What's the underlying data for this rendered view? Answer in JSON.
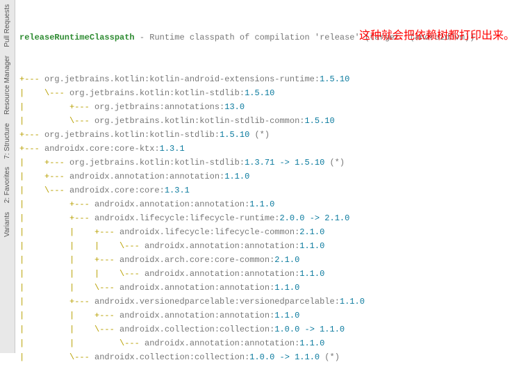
{
  "sidebar": {
    "tabs": [
      {
        "label": "Pull Requests"
      },
      {
        "label": "Resource Manager"
      },
      {
        "label": "7: Structure"
      },
      {
        "label": "2: Favorites"
      },
      {
        "label": "Variants"
      }
    ]
  },
  "header": {
    "classpath": "releaseRuntimeClasspath",
    "desc": " - Runtime classpath of compilation 'release' (target  (androidJvm))."
  },
  "annotation": "这种就会把依赖树都打印出来。也就是三方库又依赖了其他的依赖库",
  "lines": [
    {
      "prefix": "+--- ",
      "pkg": "org.jetbrains.kotlin:kotlin-android-extensions-runtime:",
      "ver": "1.5.10",
      "suffix": ""
    },
    {
      "prefix": "|    \\--- ",
      "pkg": "org.jetbrains.kotlin:kotlin-stdlib:",
      "ver": "1.5.10",
      "suffix": ""
    },
    {
      "prefix": "|         +--- ",
      "pkg": "org.jetbrains:annotations:",
      "ver": "13.0",
      "suffix": ""
    },
    {
      "prefix": "|         \\--- ",
      "pkg": "org.jetbrains.kotlin:kotlin-stdlib-common:",
      "ver": "1.5.10",
      "suffix": ""
    },
    {
      "prefix": "+--- ",
      "pkg": "org.jetbrains.kotlin:kotlin-stdlib:",
      "ver": "1.5.10",
      "suffix": " (*)"
    },
    {
      "prefix": "+--- ",
      "pkg": "androidx.core:core-ktx:",
      "ver": "1.3.1",
      "suffix": ""
    },
    {
      "prefix": "|    +--- ",
      "pkg": "org.jetbrains.kotlin:kotlin-stdlib:",
      "ver": "1.3.71 -> 1.5.10",
      "suffix": " (*)"
    },
    {
      "prefix": "|    +--- ",
      "pkg": "androidx.annotation:annotation:",
      "ver": "1.1.0",
      "suffix": ""
    },
    {
      "prefix": "|    \\--- ",
      "pkg": "androidx.core:core:",
      "ver": "1.3.1",
      "suffix": ""
    },
    {
      "prefix": "|         +--- ",
      "pkg": "androidx.annotation:annotation:",
      "ver": "1.1.0",
      "suffix": ""
    },
    {
      "prefix": "|         +--- ",
      "pkg": "androidx.lifecycle:lifecycle-runtime:",
      "ver": "2.0.0 -> 2.1.0",
      "suffix": ""
    },
    {
      "prefix": "|         |    +--- ",
      "pkg": "androidx.lifecycle:lifecycle-common:",
      "ver": "2.1.0",
      "suffix": ""
    },
    {
      "prefix": "|         |    |    \\--- ",
      "pkg": "androidx.annotation:annotation:",
      "ver": "1.1.0",
      "suffix": ""
    },
    {
      "prefix": "|         |    +--- ",
      "pkg": "androidx.arch.core:core-common:",
      "ver": "2.1.0",
      "suffix": ""
    },
    {
      "prefix": "|         |    |    \\--- ",
      "pkg": "androidx.annotation:annotation:",
      "ver": "1.1.0",
      "suffix": ""
    },
    {
      "prefix": "|         |    \\--- ",
      "pkg": "androidx.annotation:annotation:",
      "ver": "1.1.0",
      "suffix": ""
    },
    {
      "prefix": "|         +--- ",
      "pkg": "androidx.versionedparcelable:versionedparcelable:",
      "ver": "1.1.0",
      "suffix": ""
    },
    {
      "prefix": "|         |    +--- ",
      "pkg": "androidx.annotation:annotation:",
      "ver": "1.1.0",
      "suffix": ""
    },
    {
      "prefix": "|         |    \\--- ",
      "pkg": "androidx.collection:collection:",
      "ver": "1.0.0 -> 1.1.0",
      "suffix": ""
    },
    {
      "prefix": "|         |         \\--- ",
      "pkg": "androidx.annotation:annotation:",
      "ver": "1.1.0",
      "suffix": ""
    },
    {
      "prefix": "|         \\--- ",
      "pkg": "androidx.collection:collection:",
      "ver": "1.0.0 -> 1.1.0",
      "suffix": " (*)"
    }
  ]
}
